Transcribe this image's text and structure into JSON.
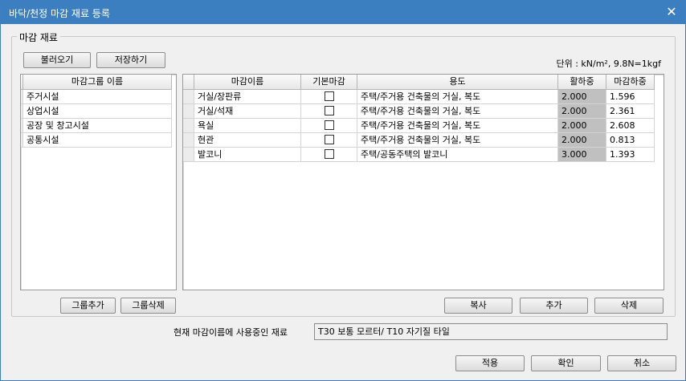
{
  "window": {
    "title": "바닥/천정 마감 재료 등록",
    "close_glyph": "✕"
  },
  "group": {
    "label": "마감 재료"
  },
  "toolbar": {
    "load_label": "불러오기",
    "save_label": "저장하기"
  },
  "unit_text": "단위 : kN/m², 9.8N=1kgf",
  "groups_panel": {
    "header": "마감그룹 이름",
    "items": [
      "주거시설",
      "상업시설",
      "공장 및 창고시설",
      "공통시설"
    ]
  },
  "materials_table": {
    "columns": [
      "마감이름",
      "기본마감",
      "용도",
      "활하중",
      "마감하중"
    ],
    "rows": [
      {
        "name": "거실/장판류",
        "default": false,
        "usage": "주택/주거용 건축물의 거실, 복도",
        "live_load": "2.000",
        "finish_load": "1.596"
      },
      {
        "name": "거실/석재",
        "default": false,
        "usage": "주택/주거용 건축물의 거실, 복도",
        "live_load": "2.000",
        "finish_load": "2.361"
      },
      {
        "name": "욕실",
        "default": false,
        "usage": "주택/주거용 건축물의 거실, 복도",
        "live_load": "2.000",
        "finish_load": "2.608"
      },
      {
        "name": "현관",
        "default": false,
        "usage": "주택/주거용 건축물의 거실, 복도",
        "live_load": "2.000",
        "finish_load": "0.813"
      },
      {
        "name": "발코니",
        "default": false,
        "usage": "주택/공동주택의 발코니",
        "live_load": "3.000",
        "finish_load": "1.393"
      }
    ]
  },
  "group_buttons": {
    "add_label": "그룹추가",
    "delete_label": "그룹삭제"
  },
  "table_buttons": {
    "copy_label": "복사",
    "add_label": "추가",
    "delete_label": "삭제"
  },
  "current": {
    "label": "현재 마감이름에 사용중인 재료",
    "value": "T30 보통 모르터/ T10 자기질 타일"
  },
  "footer": {
    "apply_label": "적용",
    "ok_label": "확인",
    "cancel_label": "취소"
  }
}
